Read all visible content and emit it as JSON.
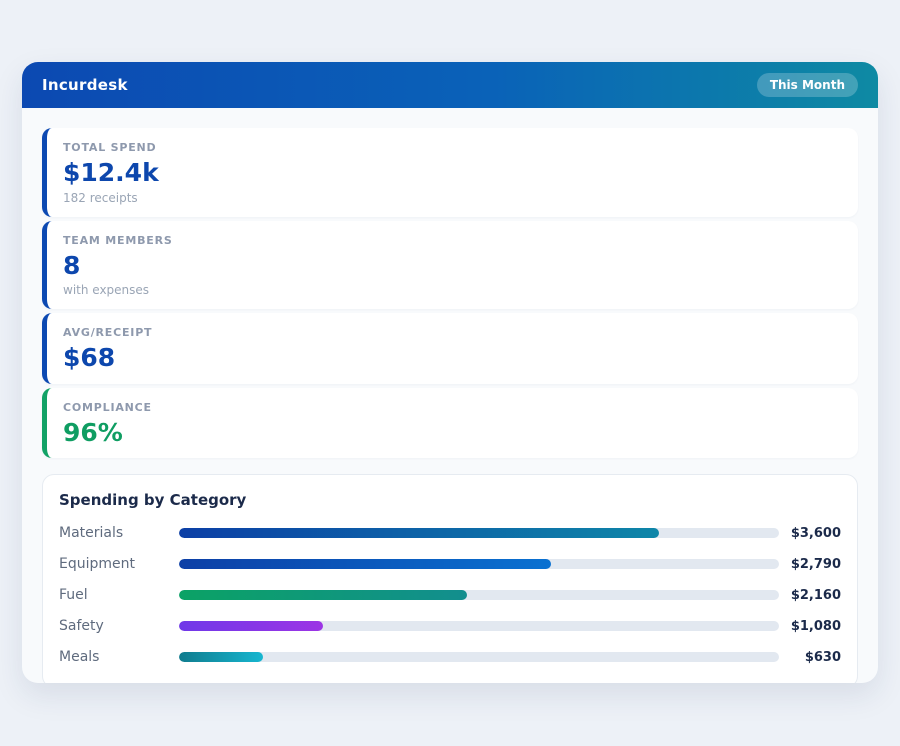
{
  "app": {
    "title": "Incurdesk",
    "badge": "This Month"
  },
  "theme": {
    "header_gradient_start": "#0c49b2",
    "header_gradient_end": "#0e8aa3",
    "page_bg": "#edf1f7",
    "card_bg": "#ffffff",
    "track_color": "#e2e8f0",
    "accent_blue": "#0c49b2",
    "accent_green": "#12a266",
    "value_blue": "#0d47ad",
    "value_green": "#0f9d62"
  },
  "stats": [
    {
      "label": "TOTAL SPEND",
      "value": "$12.4k",
      "sub": "182 receipts",
      "accent": "#0c49b2",
      "value_color": "#0d47ad"
    },
    {
      "label": "TEAM MEMBERS",
      "value": "8",
      "sub": "with expenses",
      "accent": "#0c49b2",
      "value_color": "#0d47ad"
    },
    {
      "label": "AVG/RECEIPT",
      "value": "$68",
      "sub": "",
      "accent": "#0c49b2",
      "value_color": "#0d47ad"
    },
    {
      "label": "COMPLIANCE",
      "value": "96%",
      "sub": "",
      "accent": "#12a266",
      "value_color": "#0f9d62"
    }
  ],
  "spending": {
    "title": "Spending by Category",
    "rows": [
      {
        "label": "Materials",
        "value": "$3,600",
        "percent": 80,
        "color_start": "#0c3fa6",
        "color_end": "#0e86a8"
      },
      {
        "label": "Equipment",
        "value": "$2,790",
        "percent": 62,
        "color_start": "#0c3fa6",
        "color_end": "#0a71d1"
      },
      {
        "label": "Fuel",
        "value": "$2,160",
        "percent": 48,
        "color_start": "#0ba265",
        "color_end": "#128e8e"
      },
      {
        "label": "Safety",
        "value": "$1,080",
        "percent": 24,
        "color_start": "#7038e8",
        "color_end": "#9c35e5"
      },
      {
        "label": "Meals",
        "value": "$630",
        "percent": 14,
        "color_start": "#107c8e",
        "color_end": "#17b6d0"
      }
    ]
  },
  "chart_data": {
    "type": "bar",
    "orientation": "horizontal",
    "title": "Spending by Category",
    "categories": [
      "Materials",
      "Equipment",
      "Fuel",
      "Safety",
      "Meals"
    ],
    "values": [
      3600,
      2790,
      2160,
      1080,
      630
    ],
    "value_labels": [
      "$3,600",
      "$2,790",
      "$2,160",
      "$1,080",
      "$630"
    ],
    "xlabel": "",
    "ylabel": "",
    "xlim": [
      0,
      4500
    ],
    "grid": false,
    "legend": false
  }
}
